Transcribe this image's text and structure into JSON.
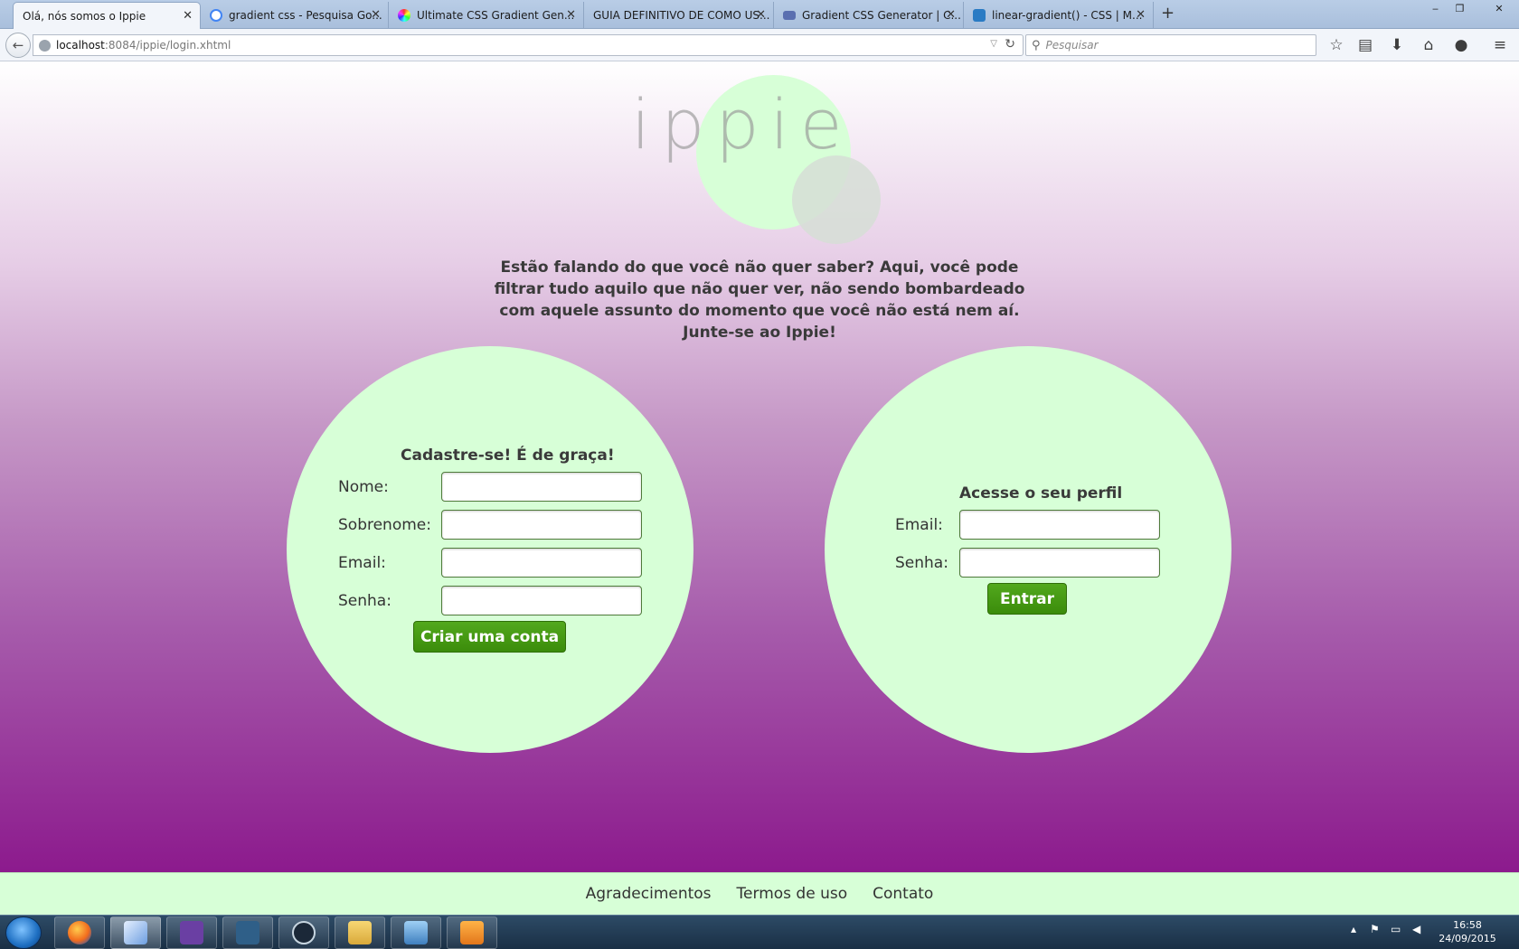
{
  "browser": {
    "tabs": [
      {
        "title": "Olá, nós somos o Ippie",
        "active": true,
        "favicon_color": "#2a4a7a"
      },
      {
        "title": "gradient css - Pesquisa Go...",
        "active": false,
        "favicon_color": "#4285f4"
      },
      {
        "title": "Ultimate CSS Gradient Gen...",
        "active": false,
        "favicon_color": "#e84c88"
      },
      {
        "title": "GUIA DEFINITIVO DE COMO US...",
        "active": false,
        "favicon_color": ""
      },
      {
        "title": "Gradient CSS Generator | C...",
        "active": false,
        "favicon_color": "#5a6fb0"
      },
      {
        "title": "linear-gradient() - CSS | M...",
        "active": false,
        "favicon_color": "#2a7bc4"
      }
    ],
    "new_tab_symbol": "+",
    "window_controls": {
      "minimize": "‒",
      "restore": "❐",
      "close": "✕"
    },
    "url_host": "localhost",
    "url_rest": ":8084/ippie/login.xhtml",
    "search_placeholder": "Pesquisar",
    "toolbar_icons": [
      "star-icon",
      "reading-list-icon",
      "download-icon",
      "home-icon",
      "chat-icon",
      "menu-icon"
    ]
  },
  "page": {
    "logo": "ippie",
    "tagline": "Estão falando do que você não quer saber? Aqui, você pode filtrar tudo aquilo que não quer ver, não sendo bombardeado com aquele assunto do momento que você não está nem aí. Junte-se ao Ippie!",
    "signup": {
      "title": "Cadastre-se! É de graça!",
      "fields": [
        {
          "label": "Nome:",
          "value": ""
        },
        {
          "label": "Sobrenome:",
          "value": ""
        },
        {
          "label": "Email:",
          "value": ""
        },
        {
          "label": "Senha:",
          "value": ""
        }
      ],
      "button": "Criar uma conta"
    },
    "login": {
      "title": "Acesse o seu perfil",
      "fields": [
        {
          "label": "Email:",
          "value": ""
        },
        {
          "label": "Senha:",
          "value": ""
        }
      ],
      "button": "Entrar"
    },
    "footer": [
      "Agradecimentos",
      "Termos de uso",
      "Contato"
    ]
  },
  "taskbar": {
    "apps": [
      "firefox",
      "virtualbox",
      "visual-studio",
      "mysql-workbench",
      "steam",
      "file-explorer",
      "photo-viewer",
      "media-player"
    ],
    "clock_time": "16:58",
    "clock_date": "24/09/2015"
  },
  "colors": {
    "circle": "#d7ffd7",
    "button": "#45991a",
    "gradient_top": "#ffffff",
    "gradient_bottom": "#8c1a8d"
  }
}
